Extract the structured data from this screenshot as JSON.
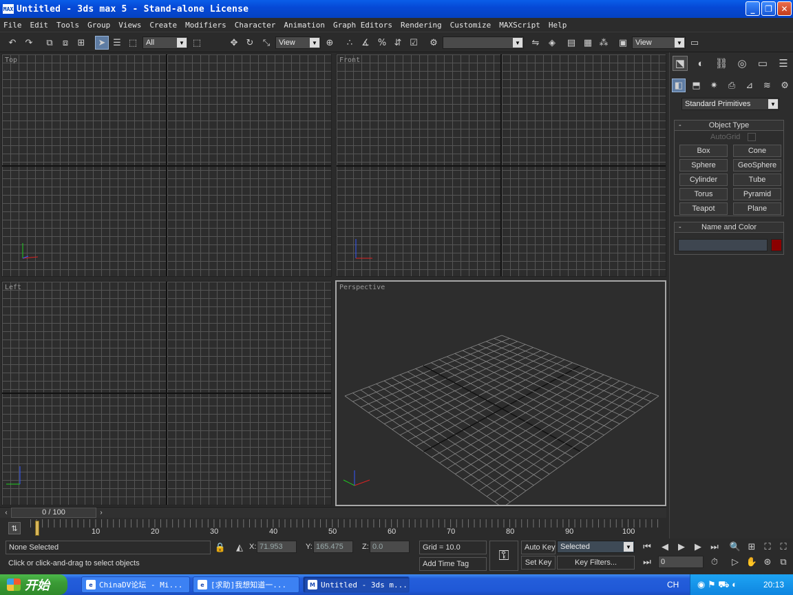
{
  "window": {
    "title": "Untitled - 3ds max 5 - Stand-alone License",
    "app_icon": "MAX",
    "buttons": [
      "minimize-icon",
      "restore-icon",
      "close-icon"
    ]
  },
  "menu": [
    "File",
    "Edit",
    "Tools",
    "Group",
    "Views",
    "Create",
    "Modifiers",
    "Character",
    "Animation",
    "Graph Editors",
    "Rendering",
    "Customize",
    "MAXScript",
    "Help"
  ],
  "toolbar": {
    "selection_filter": "All",
    "ref_coord": "View",
    "render_type": "View",
    "named_selection": ""
  },
  "viewports": {
    "top": "Top",
    "front": "Front",
    "left": "Left",
    "perspective": "Perspective"
  },
  "command_panel": {
    "category": "Standard Primitives",
    "object_type": {
      "title": "Object Type",
      "autogrid": "AutoGrid",
      "buttons": [
        "Box",
        "Cone",
        "Sphere",
        "GeoSphere",
        "Cylinder",
        "Tube",
        "Torus",
        "Pyramid",
        "Teapot",
        "Plane"
      ]
    },
    "name_color": {
      "title": "Name and Color",
      "name_value": "",
      "swatch_color": "#8b0000"
    }
  },
  "time": {
    "frame_display": "0 / 100",
    "ticks": [
      "10",
      "20",
      "30",
      "40",
      "50",
      "60",
      "70",
      "80",
      "90",
      "100"
    ]
  },
  "status": {
    "selection": "None Selected",
    "prompt": "Click or click-and-drag to select objects",
    "x_label": "X:",
    "x_value": "71.953",
    "y_label": "Y:",
    "y_value": "165.475",
    "z_label": "Z:",
    "z_value": "0.0",
    "grid": "Grid = 10.0",
    "add_time_tag": "Add Time Tag",
    "auto_key": "Auto Key",
    "set_key": "Set Key",
    "key_mode": "Selected",
    "key_filters": "Key Filters...",
    "current_frame": "0"
  },
  "taskbar": {
    "start": "开始",
    "tasks": [
      "ChinaDV论坛 - Mi...",
      "[求助]我想知道一...",
      "Untitled - 3ds m..."
    ],
    "lang": "CH",
    "clock": "20:13"
  }
}
